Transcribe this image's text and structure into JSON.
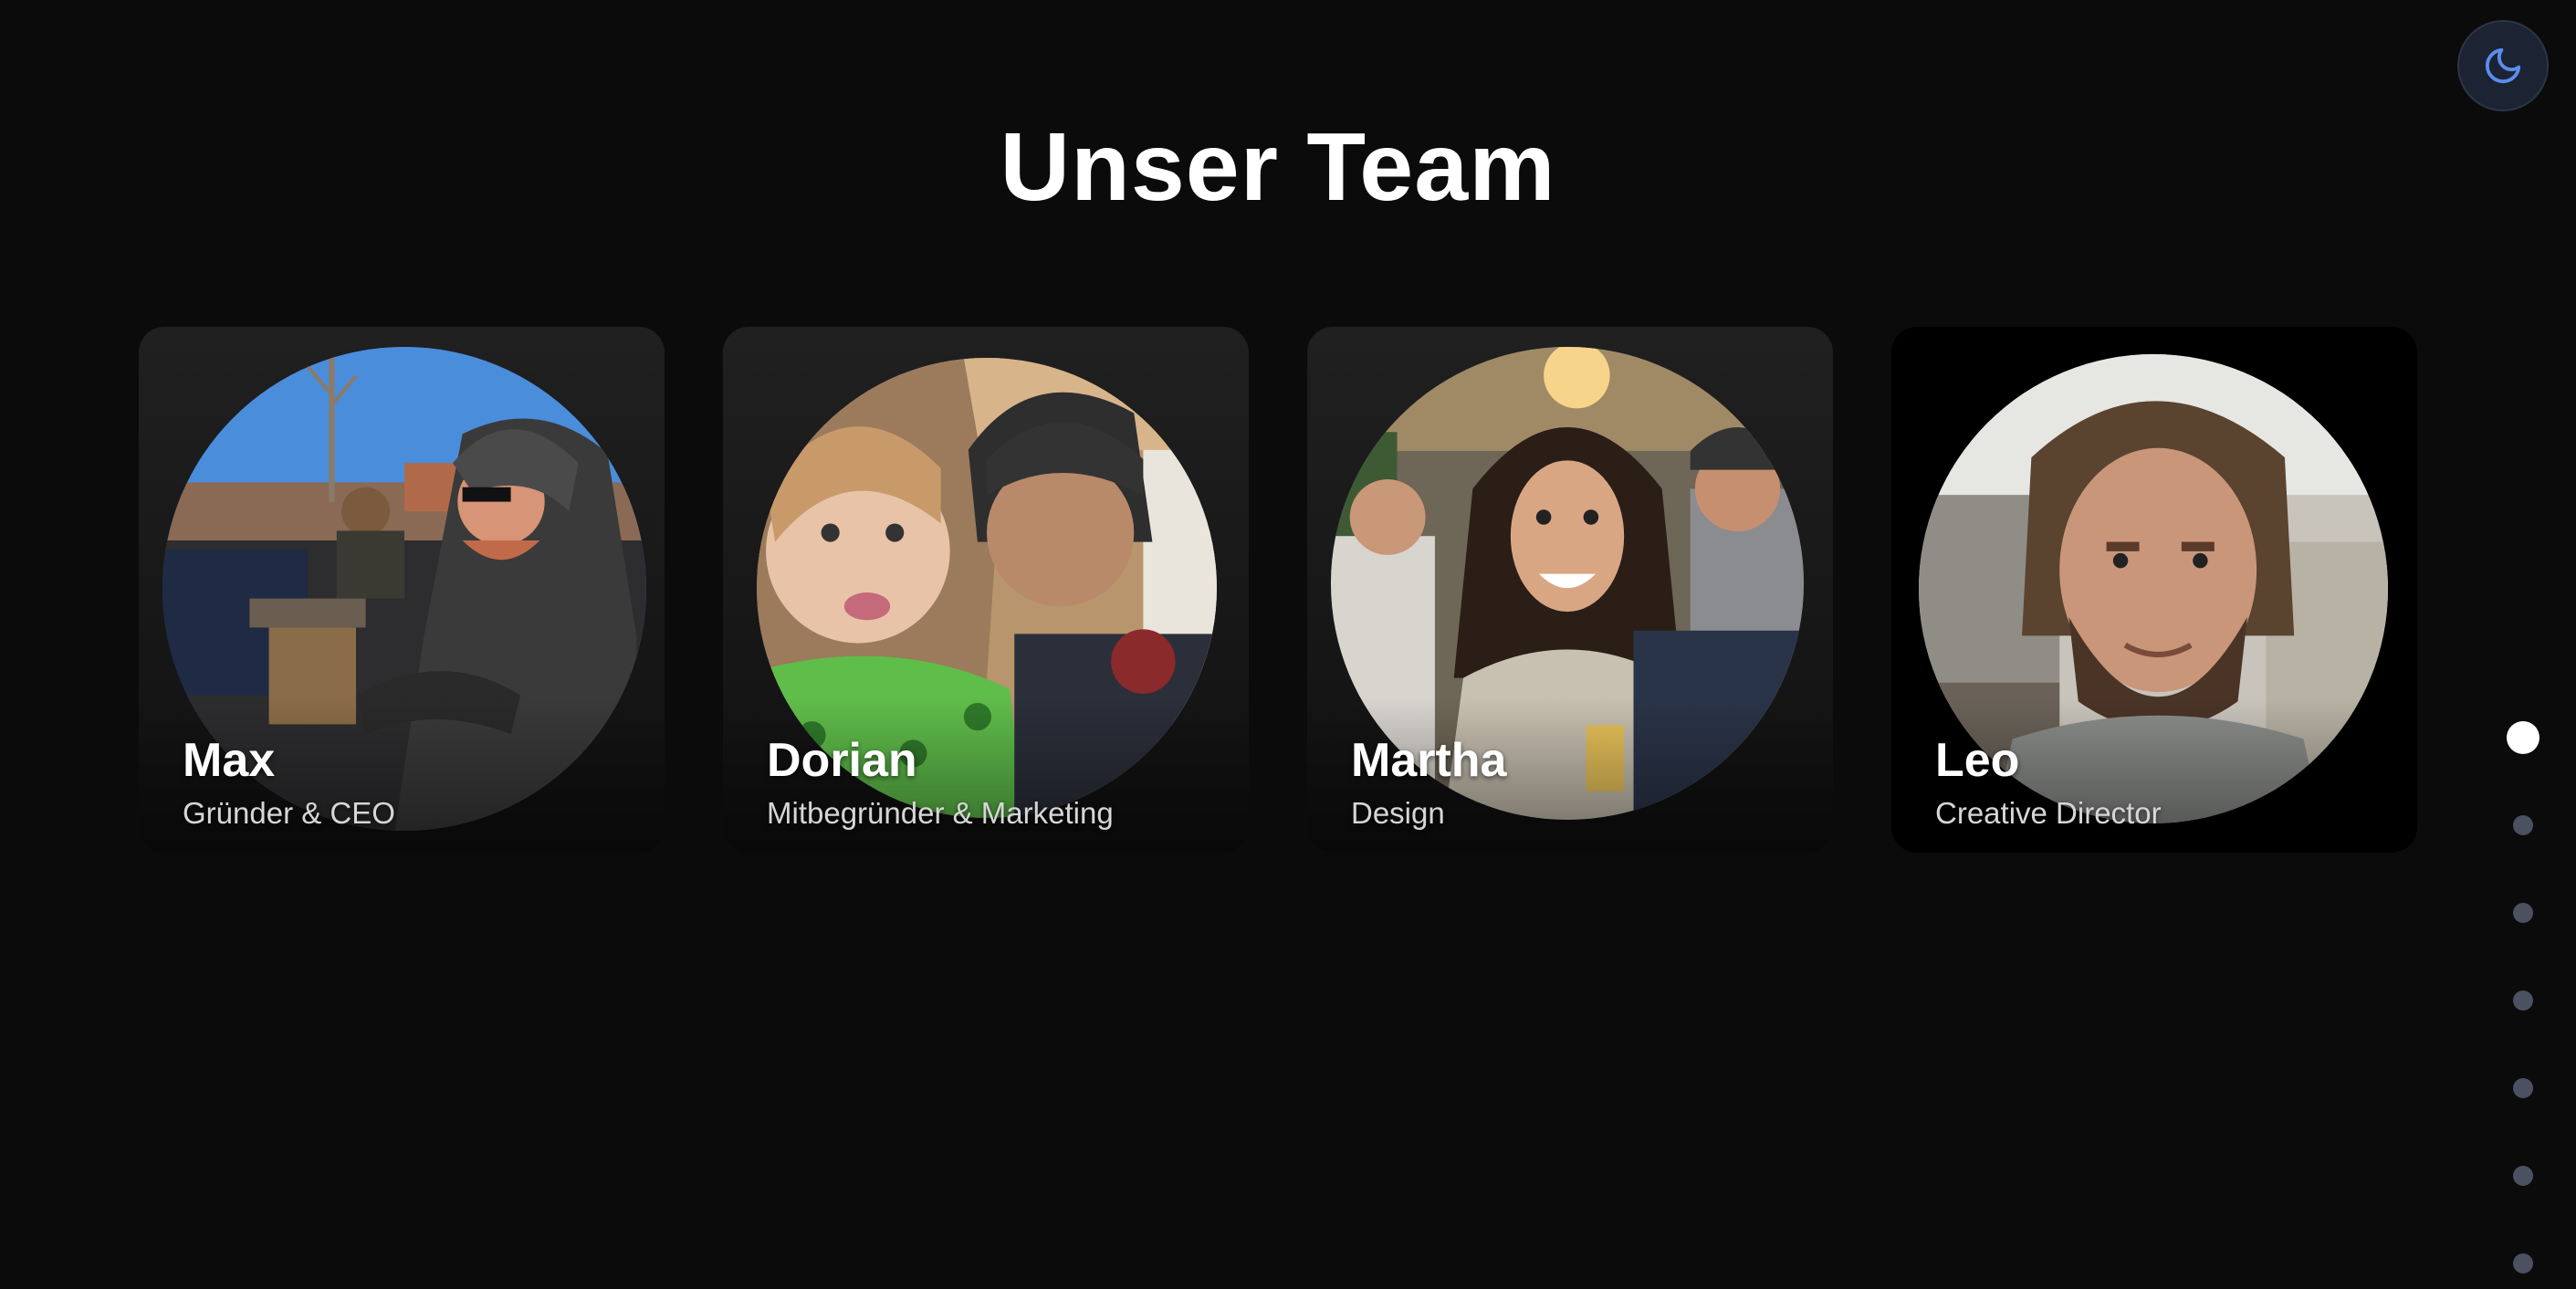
{
  "page": {
    "title": "Unser Team"
  },
  "theme_toggle": {
    "icon": "moon-icon",
    "accent": "#5b8def"
  },
  "team": [
    {
      "name": "Max",
      "role": "Gründer & CEO"
    },
    {
      "name": "Dorian",
      "role": "Mitbegründer & Marketing"
    },
    {
      "name": "Martha",
      "role": "Design"
    },
    {
      "name": "Leo",
      "role": "Creative Director"
    }
  ],
  "pagination": {
    "count": 7,
    "active_index": 0
  }
}
